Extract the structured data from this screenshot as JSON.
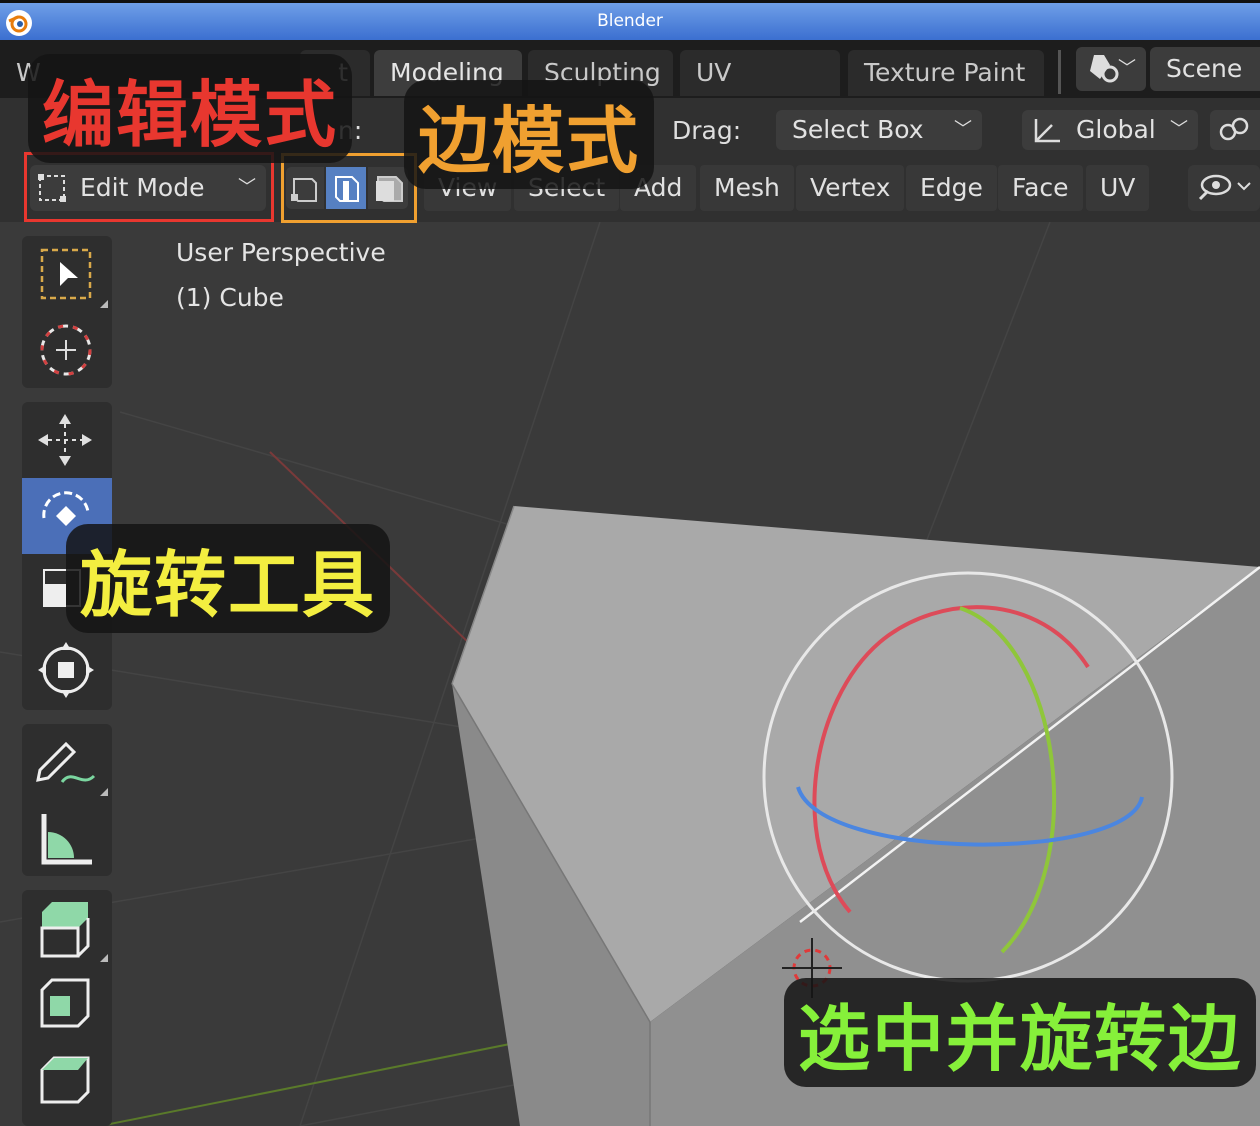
{
  "window": {
    "title": "Blender"
  },
  "tabs": [
    {
      "label": "W"
    },
    {
      "label": "t"
    },
    {
      "label": "Modeling"
    },
    {
      "label": "Sculpting"
    },
    {
      "label": "UV Editing"
    },
    {
      "label": "Texture Paint"
    }
  ],
  "scene": {
    "label": "Scene"
  },
  "header": {
    "orientation_label": "n:",
    "drag_label": "Drag:",
    "drag_value": "Select Box",
    "transform_orientation": "Global"
  },
  "mode": {
    "value": "Edit Mode"
  },
  "menus": [
    "View",
    "Select",
    "Add",
    "Mesh",
    "Vertex",
    "Edge",
    "Face",
    "UV"
  ],
  "viewport": {
    "perspective": "User Perspective",
    "object": "(1) Cube"
  },
  "annotations": {
    "edit_mode": "编辑模式",
    "edge_mode": "边模式",
    "rotate_tool": "旋转工具",
    "select_rotate_edge": "选中并旋转边",
    "colors": {
      "red": "#e8372f",
      "orange": "#f0a030",
      "yellow": "#f3ee40",
      "green": "#86f03a"
    }
  }
}
